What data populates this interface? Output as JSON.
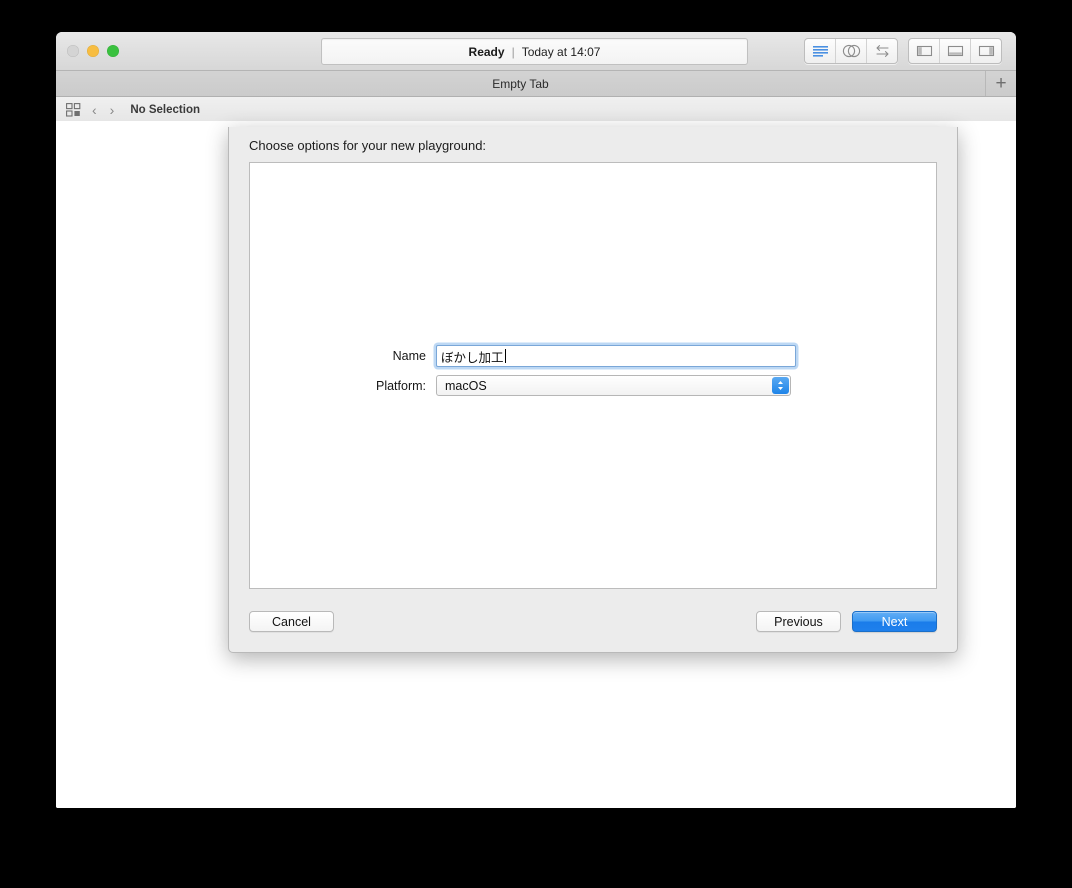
{
  "window": {
    "traffic_lights": [
      "close",
      "minimize",
      "zoom"
    ],
    "activity": {
      "status": "Ready",
      "separator": "|",
      "time": "Today at 14:07"
    },
    "toolbar": {
      "editor_modes": [
        "standard-editor-icon",
        "assistant-editor-icon",
        "version-editor-icon"
      ],
      "panel_toggles": [
        "navigator-panel-icon",
        "debug-panel-icon",
        "utilities-panel-icon"
      ]
    },
    "tabbar": {
      "tab_label": "Empty Tab",
      "add_label": "+"
    },
    "jumpbar": {
      "back_chevron": "‹",
      "forward_chevron": "›",
      "path_label": "No Selection"
    }
  },
  "sheet": {
    "title": "Choose options for your new playground:",
    "fields": [
      {
        "label": "Name",
        "value": "ぼかし加工",
        "type": "text"
      },
      {
        "label": "Platform:",
        "value": "macOS",
        "type": "popup"
      }
    ],
    "buttons": {
      "cancel": "Cancel",
      "previous": "Previous",
      "next": "Next"
    }
  },
  "colors": {
    "accent_blue": "#1a7cea",
    "focus_ring": "#6ca8e6",
    "window_chrome": "#d7d7d7",
    "sheet_bg": "#ececec",
    "traffic_close": "#d4d4d4",
    "traffic_min": "#f7bd41",
    "traffic_zoom": "#3ac13f"
  }
}
